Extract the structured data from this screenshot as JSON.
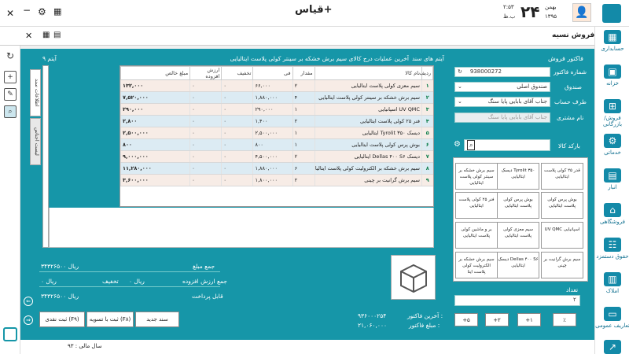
{
  "header": {
    "app_title": "قیاس+",
    "date_day": "۲۴",
    "date_month": "بهمن",
    "date_year": "۱۳۹۵",
    "clock": "۲:۵۳",
    "clock_period": "ب.ظ"
  },
  "page": {
    "title": "فروش نسیه"
  },
  "invoice": {
    "customer_invoice_label": "فاکتور فروش",
    "invoice_number_label": "شماره فاکتور",
    "invoice_number_value": "938000272",
    "fund_label": "صندوق",
    "fund_value": "صندوق اصلی",
    "account_label": "طرف حساب",
    "account_value": "جناب آقای بابایی  پایا سنگ",
    "customer_name_label": "نام مشتری",
    "customer_name_value": "جناب آقای بابایی  پایا سنگ",
    "barcode_label": "بارکد کالا",
    "quantity_label": "تعداد",
    "quantity_value": "۲"
  },
  "doc_items": {
    "count_label": "۹ آیتم",
    "title_label": "آیتم های سند",
    "last_op_label": "آخرین عملیات درج کالای سیم برش خشکه بر سینتر کولی پلاست ایتالیایی"
  },
  "grid": {
    "columns": [
      "ردیف",
      "نام کالا",
      "مقدار",
      "فی",
      "تخفیف",
      "ارزش افزوده",
      "مبلغ خالص"
    ],
    "rows": [
      {
        "idx": "۱",
        "name": "سیم معزی کولی پلاست ایتالیایی",
        "qty": "۲",
        "price": "۶۶,۰۰۰",
        "disc": "۰",
        "vat": "۰",
        "net": "۱۳۲,۰۰۰"
      },
      {
        "idx": "۲",
        "name": "سیم برش خشکه بر سینتر کولی پلاست ایتالیایی",
        "qty": "۴",
        "price": "۱,۸۸۰,۰۰۰",
        "disc": "۰",
        "vat": "۰",
        "net": "۷,۵۲۰,۰۰۰"
      },
      {
        "idx": "۳",
        "name": "UV QMC اسپانیایی",
        "qty": "۱",
        "price": "۲۹۰,۰۰۰",
        "disc": "۰",
        "vat": "۰",
        "net": "۲۹۰,۰۰۰"
      },
      {
        "idx": "۴",
        "name": "فنر ۲۵ کولی پلاست ایتالیایی",
        "qty": "۲",
        "price": "۱,۴۰۰",
        "disc": "۰",
        "vat": "۰",
        "net": "۲,۸۰۰"
      },
      {
        "idx": "۵",
        "name": "دیسک Tyrolit ۳۵۰ ایتالیایی",
        "qty": "۱",
        "price": "۲,۵۰۰,۰۰۰",
        "disc": "۰",
        "vat": "۰",
        "net": "۲,۵۰۰,۰۰۰"
      },
      {
        "idx": "۶",
        "name": "بوش پرس کولی پلاست ایتالیایی",
        "qty": "۱",
        "price": "۸۰۰",
        "disc": "۰",
        "vat": "۰",
        "net": "۸۰۰"
      },
      {
        "idx": "۷",
        "name": "دیسک Dellas ۴۰۰ S۶ ایتالیایی",
        "qty": "۲",
        "price": "۴,۵۰۰,۰۰۰",
        "disc": "۰",
        "vat": "۰",
        "net": "۹,۰۰۰,۰۰۰"
      },
      {
        "idx": "۸",
        "name": "سیم برش خشکه بر الکترولیت کولی پلاست ایتالیایی",
        "qty": "۶",
        "price": "۱,۸۸۰,۰۰۰",
        "disc": "۰",
        "vat": "۰",
        "net": "۱۱,۲۸۰,۰۰۰"
      },
      {
        "idx": "۹",
        "name": "سیم برش گرانیت بر چینی",
        "qty": "۲",
        "price": "۱,۸۰۰,۰۰۰",
        "disc": "۰",
        "vat": "۰",
        "net": "۳,۶۰۰,۰۰۰"
      }
    ]
  },
  "side_tabs": {
    "doc_info": "اطلاعات سند",
    "products_list": "لیست اجناس"
  },
  "tiles": [
    "قدر ۲۵ کولی پلاست ایتالیایی",
    "دیسک Tyrolit ۳۵۰ ایتالیایی",
    "سیم برش خشکه بر سینتر کولی پلاست ایتالیایی",
    "بوش پرس کولی پلاست ایتالیایی",
    "بوش پرس کولی پلاست ایتالیایی",
    "فنر ۲۵ کولی پلاست ایتالیایی",
    "UV QMC اسپانیایی",
    "سیم معزی کولی پلاست ایتالیایی",
    "بر و ماشین کولی پلاست ایتالیایی",
    "سیم برش گرانیت بر چینی",
    "دیسک Dellas ۴۰۰ S۶ ایتالیایی",
    "سیم برش خشکه بر الکترولیت کولی پلاست ایتا"
  ],
  "qty_buttons": [
    "٪",
    "+۱",
    "+۲",
    "+۵"
  ],
  "totals": {
    "sum_label": "جمع مبلغ",
    "sum_value": "۳۴۳۲۶۵۰۰ ریال",
    "vat_label": "جمع ارزش افزوده",
    "vat_value": "۰ ریال",
    "discount_label": "تخفیف",
    "discount_value": "۰ ریال",
    "payable_label": "قابل پرداخت",
    "payable_value": "۳۴۳۲۶۵۰۰ ریال"
  },
  "last_invoice": {
    "number_label": "آخرین فاکتور :",
    "number_value": "۹۳۶۰۰۰۲۵۴",
    "amount_label": "مبلغ فاکتور :",
    "amount_value": "۲۱,۰۶۰,۰۰۰"
  },
  "actions": {
    "new_doc": "سند جدید",
    "save_settle": "ثبت با تسویه (F۸)",
    "save_cash": "ثبت نقدی (F۹)"
  },
  "nav": [
    {
      "label": "حسابداری",
      "icon": "calculator-icon"
    },
    {
      "label": "خزانه",
      "icon": "vault-icon"
    },
    {
      "label": "فروش/بازرگانی",
      "icon": "cart-icon"
    },
    {
      "label": "خدماتی",
      "icon": "gear-icon"
    },
    {
      "label": "انبار",
      "icon": "warehouse-icon"
    },
    {
      "label": "فروشگاهی",
      "icon": "store-icon"
    },
    {
      "label": "حقوق دستمزد",
      "icon": "payroll-icon"
    },
    {
      "label": "املاک",
      "icon": "building-icon"
    },
    {
      "label": "تعاریف عمومی",
      "icon": "book-icon"
    }
  ],
  "footer": {
    "fiscal_year": "سال مالی : ۹۳"
  }
}
